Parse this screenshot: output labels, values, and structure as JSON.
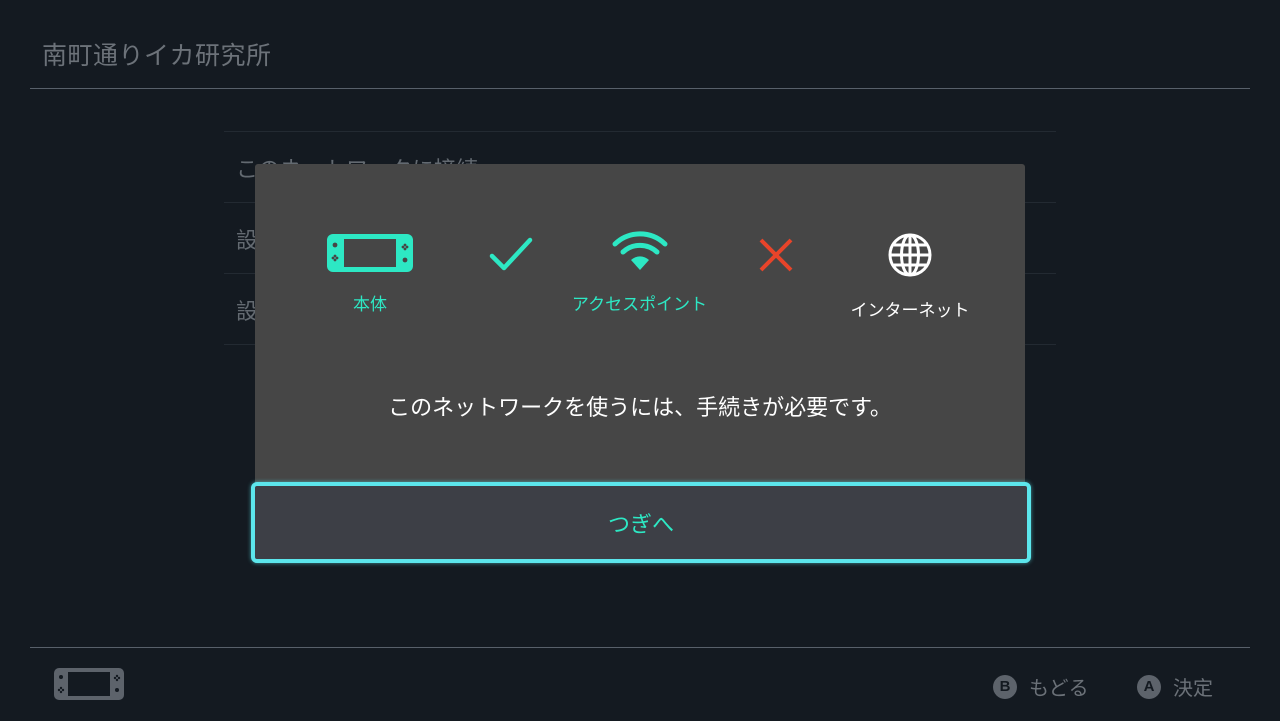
{
  "page": {
    "title": "南町通りイカ研究所",
    "list_items": [
      "このネットワークに接続",
      "設",
      "設"
    ]
  },
  "dialog": {
    "status": {
      "console": {
        "label": "本体",
        "icon": "console-icon",
        "state": "connected"
      },
      "link_console_ap": {
        "icon": "check-icon",
        "state": "ok"
      },
      "access_point": {
        "label": "アクセスポイント",
        "icon": "wifi-icon",
        "state": "connected"
      },
      "link_ap_internet": {
        "icon": "cross-icon",
        "state": "failed"
      },
      "internet": {
        "label": "インターネット",
        "icon": "globe-icon",
        "state": "unreachable"
      }
    },
    "message": "このネットワークを使うには、手続きが必要です。",
    "next_button": "つぎへ"
  },
  "footer": {
    "back": {
      "glyph": "B",
      "label": "もどる"
    },
    "ok": {
      "glyph": "A",
      "label": "決定"
    }
  },
  "colors": {
    "background": "#141a21",
    "dialog": "#464646",
    "accent_teal": "#2de8c4",
    "focus_border": "#5ce6ec",
    "error_red": "#e8442a"
  }
}
